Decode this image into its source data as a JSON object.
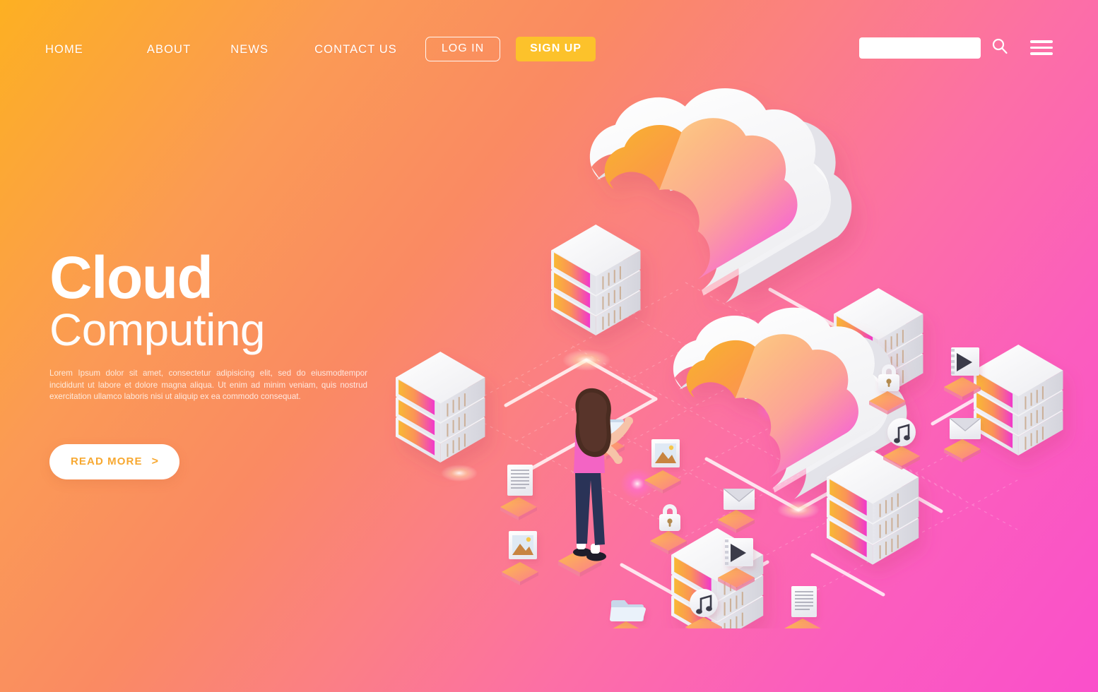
{
  "nav": {
    "links": [
      {
        "label": "HOME",
        "name": "nav-link-home"
      },
      {
        "label": "ABOUT",
        "name": "nav-link-about"
      },
      {
        "label": "NEWS",
        "name": "nav-link-news"
      },
      {
        "label": "CONTACT US",
        "name": "nav-link-contact-us"
      }
    ],
    "login_label": "LOG IN",
    "signup_label": "SIGN UP",
    "search_value": "",
    "search_placeholder": "",
    "search_icon": "search-icon",
    "menu_icon": "hamburger-menu-icon"
  },
  "hero": {
    "title": "Cloud",
    "subtitle": "Computing",
    "paragraph": "Lorem Ipsum dolor sit amet, consectetur adipisicing elit, sed do eiusmodtempor incididunt ut labore et dolore magna aliqua. Ut enim ad minim veniam, quis nostrud exercitation ullamco laboris nisi ut aliquip ex ea commodo consequat.",
    "cta_label": "READ MORE",
    "cta_arrow": ">"
  },
  "illustration": {
    "title": "isometric cloud computing network",
    "clouds": [
      {
        "name": "cloud-upper"
      },
      {
        "name": "cloud-lower"
      }
    ],
    "servers": [
      {
        "name": "server-rack-left"
      },
      {
        "name": "server-rack-top-center"
      },
      {
        "name": "server-rack-top-right"
      },
      {
        "name": "server-rack-right"
      },
      {
        "name": "server-rack-center-right"
      },
      {
        "name": "server-rack-bottom"
      }
    ],
    "file_icons": [
      {
        "name": "document-icon"
      },
      {
        "name": "image-icon"
      },
      {
        "name": "image-icon"
      },
      {
        "name": "lock-icon"
      },
      {
        "name": "lock-icon"
      },
      {
        "name": "folder-icon"
      },
      {
        "name": "music-note-icon"
      },
      {
        "name": "music-note-icon"
      },
      {
        "name": "mail-icon"
      },
      {
        "name": "mail-icon"
      },
      {
        "name": "video-icon"
      },
      {
        "name": "video-icon"
      },
      {
        "name": "document-icon"
      }
    ],
    "character": {
      "name": "person-avatar"
    }
  },
  "colors": {
    "bg_orange": "#FDB022",
    "bg_pink": "#FA4FCB",
    "accent_yellow": "#FCC22B",
    "cta_text": "#F7A830",
    "white": "#FFFFFF",
    "cloud_orange": "#F9A72B",
    "cloud_magenta": "#F637C8",
    "person_top": "#F364C4",
    "person_pants": "#2A3357",
    "person_hair": "#4A2C21"
  }
}
